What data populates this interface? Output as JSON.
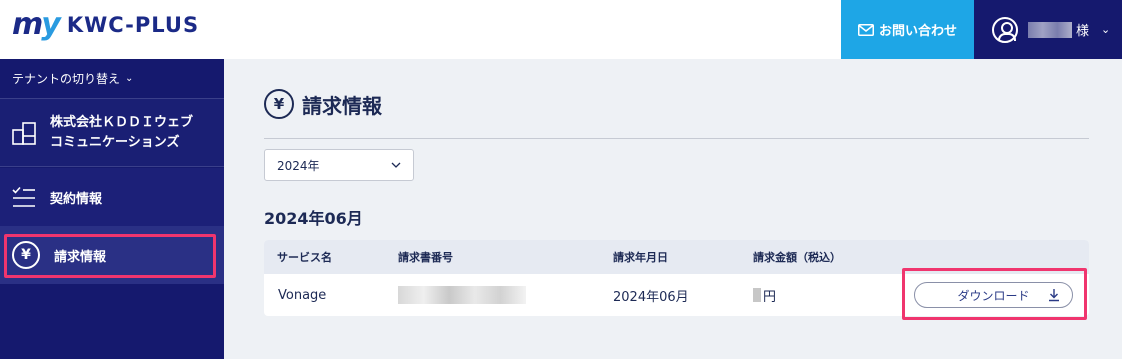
{
  "header": {
    "logo_mark": "my",
    "logo_text": "KWC-PLUS",
    "contact_label": "お問い合わせ",
    "user_suffix": "様"
  },
  "sidebar": {
    "tenant_switch": "テナントの切り替え",
    "company_line1": "株式会社ＫＤＤＩウェブ",
    "company_line2": "コミュニケーションズ",
    "items": [
      {
        "label": "契約情報",
        "icon": "checklist-icon"
      },
      {
        "label": "請求情報",
        "icon": "yen-icon",
        "active": true
      }
    ]
  },
  "main": {
    "title": "請求情報",
    "year_select": {
      "value": "2024年"
    },
    "month_heading": "2024年06月",
    "table": {
      "headers": [
        "サービス名",
        "請求書番号",
        "請求年月日",
        "請求金額（税込）"
      ],
      "rows": [
        {
          "service": "Vonage",
          "invoice_no": "",
          "date": "2024年06月",
          "amount_suffix": "円",
          "action": "ダウンロード"
        }
      ]
    }
  },
  "colors": {
    "navy": "#15196e",
    "accent_blue": "#1ea6e6",
    "highlight": "#f0356e"
  }
}
